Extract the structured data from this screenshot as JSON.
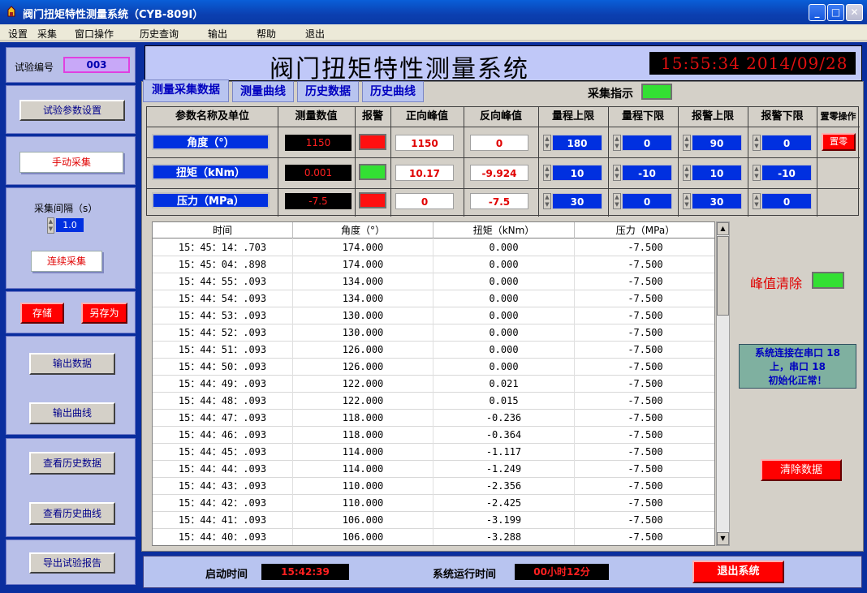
{
  "window": {
    "title": "阀门扭矩特性测量系统（CYB-809I）"
  },
  "menu": [
    "设置",
    "采集",
    "窗口操作",
    "历史查询",
    "输出",
    "帮助",
    "退出"
  ],
  "header": {
    "title": "阀门扭矩特性测量系统",
    "clock": "15:55:34  2014/09/28"
  },
  "left": {
    "test_no_label": "试验编号",
    "test_no": "003",
    "param_setting": "试验参数设置",
    "manual_collect": "手动采集",
    "interval_label": "采集间隔（s）",
    "interval_value": "1.0",
    "continuous_collect": "连续采集",
    "save": "存储",
    "save_as": "另存为",
    "output_data": "输出数据",
    "output_curve": "输出曲线",
    "view_history_data": "查看历史数据",
    "view_history_curve": "查看历史曲线",
    "export_report": "导出试验报告"
  },
  "tabs": [
    "测量采集数据",
    "测量曲线",
    "历史数据",
    "历史曲线"
  ],
  "collect_indicator": "采集指示",
  "param_table": {
    "headers": [
      "参数名称及单位",
      "测量数值",
      "报警",
      "正向峰值",
      "反向峰值",
      "量程上限",
      "量程下限",
      "报警上限",
      "报警下限",
      "置零操作"
    ],
    "rows": [
      {
        "name": "角度（°）",
        "value": "1150",
        "pos_peak": "1150",
        "neg_peak": "0",
        "range_hi": "180",
        "range_lo": "0",
        "alarm_hi": "90",
        "alarm_lo": "0"
      },
      {
        "name": "扭矩（kNm）",
        "value": "0.001",
        "pos_peak": "10.17",
        "neg_peak": "-9.924",
        "range_hi": "10",
        "range_lo": "-10",
        "alarm_hi": "10",
        "alarm_lo": "-10"
      },
      {
        "name": "压力（MPa）",
        "value": "-7.5",
        "pos_peak": "0",
        "neg_peak": "-7.5",
        "range_hi": "30",
        "range_lo": "0",
        "alarm_hi": "30",
        "alarm_lo": "0"
      }
    ],
    "zero_button": "置零"
  },
  "grid": {
    "headers": [
      "时间",
      "角度（°）",
      "扭矩（kNm）",
      "压力（MPa）"
    ],
    "rows": [
      [
        "15：45：14：.703",
        "174.000",
        "0.000",
        "-7.500"
      ],
      [
        "15：45：04：.898",
        "174.000",
        "0.000",
        "-7.500"
      ],
      [
        "15：44：55：.093",
        "134.000",
        "0.000",
        "-7.500"
      ],
      [
        "15：44：54：.093",
        "134.000",
        "0.000",
        "-7.500"
      ],
      [
        "15：44：53：.093",
        "130.000",
        "0.000",
        "-7.500"
      ],
      [
        "15：44：52：.093",
        "130.000",
        "0.000",
        "-7.500"
      ],
      [
        "15：44：51：.093",
        "126.000",
        "0.000",
        "-7.500"
      ],
      [
        "15：44：50：.093",
        "126.000",
        "0.000",
        "-7.500"
      ],
      [
        "15：44：49：.093",
        "122.000",
        "0.021",
        "-7.500"
      ],
      [
        "15：44：48：.093",
        "122.000",
        "0.015",
        "-7.500"
      ],
      [
        "15：44：47：.093",
        "118.000",
        "-0.236",
        "-7.500"
      ],
      [
        "15：44：46：.093",
        "118.000",
        "-0.364",
        "-7.500"
      ],
      [
        "15：44：45：.093",
        "114.000",
        "-1.117",
        "-7.500"
      ],
      [
        "15：44：44：.093",
        "114.000",
        "-1.249",
        "-7.500"
      ],
      [
        "15：44：43：.093",
        "110.000",
        "-2.356",
        "-7.500"
      ],
      [
        "15：44：42：.093",
        "110.000",
        "-2.425",
        "-7.500"
      ],
      [
        "15：44：41：.093",
        "106.000",
        "-3.199",
        "-7.500"
      ],
      [
        "15：44：40：.093",
        "106.000",
        "-3.288",
        "-7.500"
      ]
    ]
  },
  "right": {
    "peak_clear": "峰值清除",
    "status_line1": "系统连接在串口 18",
    "status_line2": "上，串口 18",
    "status_line3": "初始化正常！",
    "clear_data": "清除数据"
  },
  "bottom": {
    "start_label": "启动时间",
    "start_value": "15:42:39",
    "run_label": "系统运行时间",
    "run_value": "00小时12分",
    "exit": "退出系统"
  },
  "colors": {
    "accent_blue": "#0030e0",
    "panel_blue": "#0a2e9e",
    "alarm_red": "#ff1010",
    "ok_green": "#33e033"
  }
}
